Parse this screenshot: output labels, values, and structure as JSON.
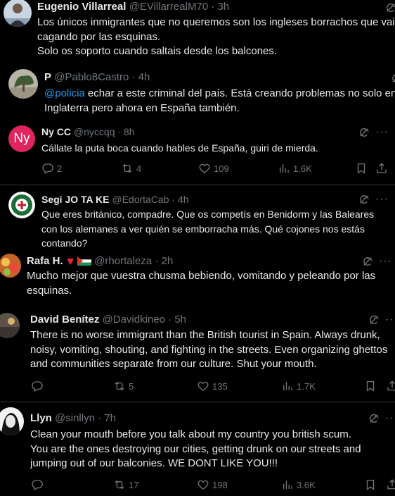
{
  "tweets": [
    {
      "name": "Eugenio Villarreal",
      "handle": "@EVillarrealM70",
      "time": "3h",
      "body": "Los únicos inmigrantes que no queremos son los ingleses borrachos que vais cagando por las esquinas.\nSolo os soporto cuando saltais desde los balcones."
    },
    {
      "name": "P",
      "handle": "@Pablo8Castro",
      "time": "4h",
      "mention": "@policia",
      "body": " echar a este criminal del país. Está creando problemas no solo en Inglaterra pero ahora en España también."
    },
    {
      "name": "Ny CC",
      "handle": "@nyccqq",
      "time": "8h",
      "avatar_text": "Ny",
      "body": "Cállate la puta boca cuando hables de España, guiri de mierda.",
      "replies": "2",
      "reposts": "4",
      "likes": "109",
      "views": "1.6K"
    },
    {
      "name": "Segi JO TA KE",
      "handle": "@EdortaCab",
      "time": "4h",
      "body": "Que eres británico, compadre. Que os competís en Benidorm y las Baleares con los alemanes a ver quién se emborracha más. Qué cojones nos estás contando?"
    },
    {
      "name": "Rafa H.",
      "handle": "@rhortaleza",
      "time": "2h",
      "body": "Mucho mejor que vuestra chusma bebiendo, vomitando y peleando por las esquinas."
    },
    {
      "name": "David Benítez",
      "handle": "@Davidkineo",
      "time": "5h",
      "body": "There is no worse immigrant than the British tourist in Spain. Always drunk, noisy, vomiting, shouting, and fighting in the streets. Even organizing ghettos and communities separate from our culture. Shut your mouth.",
      "replies": "",
      "reposts": "5",
      "likes": "135",
      "views": "1.7K"
    },
    {
      "name": "Llyn",
      "handle": "@sinllyn",
      "time": "7h",
      "body": "Clean your mouth before you talk about my country you british scum.\nYou are the ones destroying our cities, getting drunk on our streets and jumping out of our balconies. WE DONT LIKE YOU!!!",
      "replies": "",
      "reposts": "17",
      "likes": "198",
      "views": "3.6K"
    }
  ],
  "ui": {
    "dot": "·",
    "more": "···"
  },
  "colors": {
    "background": "#000000",
    "text": "#e7e9ea",
    "muted": "#71767b",
    "link": "#1d9bf0",
    "ny_avatar": "#e0245e"
  }
}
